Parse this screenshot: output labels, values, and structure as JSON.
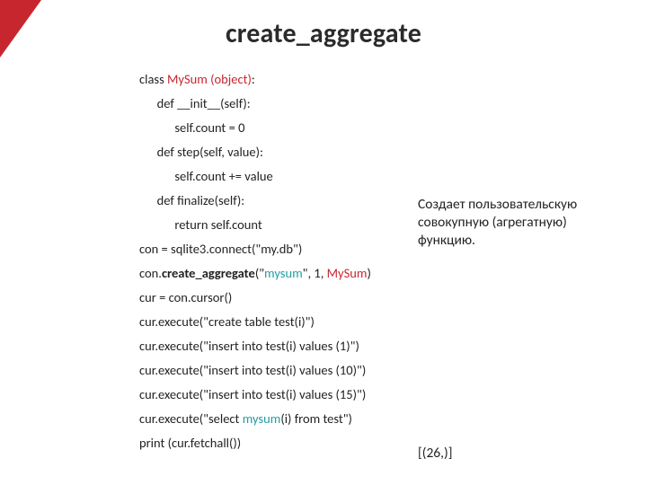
{
  "title": "create_aggregate",
  "code": {
    "l1a": "class ",
    "l1b": "MySum (object)",
    "l1c": ":",
    "l2": "      def __init__(self):",
    "l3": "            self.count = 0",
    "l4": "      def step(self, value):",
    "l5": "            self.count += value",
    "l6": "      def finalize(self):",
    "l7": "            return self.count",
    "l8": "con = sqlite3.connect(\"my.db\")",
    "l9a": "con.",
    "l9b": "create_aggregate",
    "l9c": "(\"",
    "l9d": "mysum",
    "l9e": "\", 1, ",
    "l9f": "MySum",
    "l9g": ")",
    "l10": "cur = con.cursor()",
    "l11": "cur.execute(\"create table test(i)\")",
    "l12": "cur.execute(\"insert into test(i) values (1)\")",
    "l13": "cur.execute(\"insert into test(i) values (10)\")",
    "l14": "cur.execute(\"insert into test(i) values (15)\")",
    "l15a": "cur.execute(\"select ",
    "l15b": "mysum",
    "l15c": "(i) from test\")",
    "l16": "print (cur.fetchall())"
  },
  "description": "Создает пользовательскую совокупную (агрегатную) функцию.",
  "result": "[(26,)]"
}
